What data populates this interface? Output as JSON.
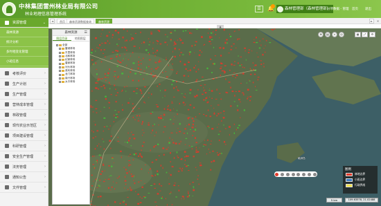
{
  "header": {
    "title": "中林集团雷州林业局有限公司",
    "subtitle": "林业地理信息管理系统",
    "user_label": "森林管理部（森林管理部）",
    "links": [
      "分项数据 - 管理",
      "首页",
      "退出"
    ],
    "colors": {
      "primary": "#6aa82c",
      "dark": "#3f7f15"
    }
  },
  "tabs": {
    "prev": "◄",
    "next": "►",
    "items": [
      "首页",
      "森林资源数据查询",
      "森林资源"
    ],
    "active_index": 2,
    "close": "✕",
    "collapse": "▲"
  },
  "sidebar": {
    "section": {
      "label": "资源管理",
      "icon": "tree-icon"
    },
    "sub_items": [
      "森林资源",
      "统计分析",
      "多时相变化管理",
      "小班信息"
    ],
    "items": [
      {
        "label": "考核评价",
        "icon": "check-icon"
      },
      {
        "label": "生产计划",
        "icon": "plan-icon"
      },
      {
        "label": "生产管理",
        "icon": "production-icon"
      },
      {
        "label": "营林成本管理",
        "icon": "cost-icon"
      },
      {
        "label": "林政管理",
        "icon": "admin-icon"
      },
      {
        "label": "现代农业示范区",
        "icon": "farm-icon"
      },
      {
        "label": "项目建设管理",
        "icon": "project-icon"
      },
      {
        "label": "科研管理",
        "icon": "research-icon"
      },
      {
        "label": "安全生产管理",
        "icon": "safety-icon"
      },
      {
        "label": "法务管理",
        "icon": "law-icon"
      },
      {
        "label": "通知公告",
        "icon": "notice-icon"
      },
      {
        "label": "文件管理",
        "icon": "file-icon"
      }
    ]
  },
  "panel": {
    "title": "森林资源",
    "menu": "☰",
    "tabs": [
      "图层目录",
      "地图图层"
    ],
    "active_tab": 0,
    "tree": [
      {
        "label": "全部",
        "indent": 0
      },
      {
        "label": "雷城林场",
        "indent": 1
      },
      {
        "label": "东里林场",
        "indent": 1
      },
      {
        "label": "北和林场",
        "indent": 1
      },
      {
        "label": "纪家林场",
        "indent": 1
      },
      {
        "label": "唐家林场",
        "indent": 1
      },
      {
        "label": "河头林场",
        "indent": 1
      },
      {
        "label": "英利林场",
        "indent": 1
      },
      {
        "label": "龙门林场",
        "indent": 1
      },
      {
        "label": "南兴林场",
        "indent": 1
      },
      {
        "label": "太平林场",
        "indent": 1
      }
    ]
  },
  "map": {
    "place_labels": [
      "硇洲岛"
    ],
    "legend": {
      "title": "图例",
      "items": [
        {
          "label": "林地边界",
          "color": "#e23a2a"
        },
        {
          "label": "小班边界",
          "color": "#3a7ac0"
        },
        {
          "label": "行政界线",
          "color": "#f2e24a"
        }
      ]
    },
    "scale": "5 km",
    "coords": "109.63578, 21.02488",
    "colors": {
      "forest": "#e23a2a",
      "sea": "#2f5f78",
      "land": "#56694b",
      "green": "#43c63a"
    }
  }
}
